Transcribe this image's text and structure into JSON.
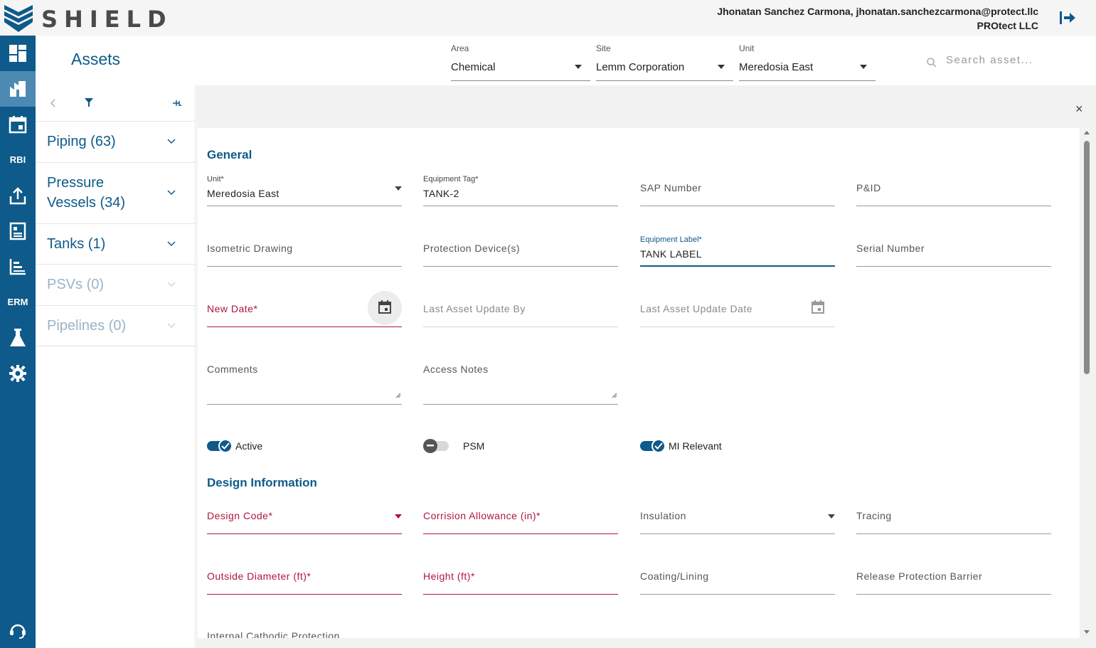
{
  "app": {
    "name": "SHIELD",
    "page_title": "Assets"
  },
  "user": {
    "line1": "Jhonatan Sanchez Carmona, jhonatan.sanchezcarmona@protect.llc",
    "line2": "PROtect LLC"
  },
  "sidebar": {
    "rbi_label": "RBI",
    "erm_label": "ERM"
  },
  "filters": {
    "area": {
      "label": "Area",
      "value": "Chemical"
    },
    "site": {
      "label": "Site",
      "value": "Lemm Corporation"
    },
    "unit": {
      "label": "Unit",
      "value": "Meredosia East"
    },
    "search_placeholder": "Search asset..."
  },
  "categories": [
    {
      "name": "Piping (63)"
    },
    {
      "name": "Pressure Vessels (34)"
    },
    {
      "name": "Tanks (1)"
    },
    {
      "name": "PSVs (0)"
    },
    {
      "name": "Pipelines (0)"
    }
  ],
  "close_label": "×",
  "general": {
    "title": "General",
    "unit": {
      "label": "Unit*",
      "value": "Meredosia East"
    },
    "equipment_tag": {
      "label": "Equipment Tag*",
      "value": "TANK-2"
    },
    "sap_number": "SAP Number",
    "pid": "P&ID",
    "isometric_drawing": "Isometric Drawing",
    "protection_devices": "Protection Device(s)",
    "equipment_label": {
      "label": "Equipment Label*",
      "value": "TANK LABEL"
    },
    "serial_number": "Serial Number",
    "new_date": "New Date*",
    "last_update_by": "Last Asset Update By",
    "last_update_date": "Last Asset Update Date",
    "comments": "Comments",
    "access_notes": "Access Notes",
    "toggles": {
      "active": "Active",
      "psm": "PSM",
      "mi_relevant": "MI Relevant"
    }
  },
  "design": {
    "title": "Design Information",
    "design_code": "Design Code*",
    "corrosion_allowance": "Corrision Allowance (in)*",
    "insulation": "Insulation",
    "tracing": "Tracing",
    "outside_diameter": "Outside Diameter (ft)*",
    "height": "Height (ft)*",
    "coating": "Coating/Lining",
    "release_barrier": "Release Protection Barrier",
    "internal_cathodic": "Internal Cathodic Protection"
  },
  "colors": {
    "brand": "#0e5a8a",
    "error": "#b0163c",
    "sidebar_active": "#4d8ab3"
  }
}
